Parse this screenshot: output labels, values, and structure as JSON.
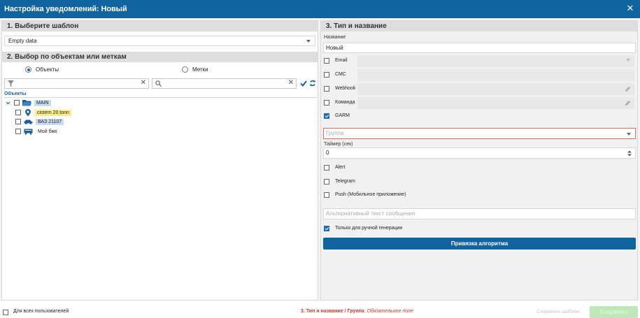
{
  "window": {
    "title": "Настройка уведомлений: Новый"
  },
  "left": {
    "section1_title": "1. Выберите шаблон",
    "template_value": "Empty data",
    "section2_title": "2. Выбор по объектам или меткам",
    "radio_objects": "Объекты",
    "radio_labels": "Метки",
    "tree_title": "Объекты",
    "tree": [
      {
        "label": "MAIN",
        "icon": "folder-icon",
        "highlight": "#c8dcf2"
      },
      {
        "label": "cistern 20 tonn",
        "icon": "map-pin-icon",
        "highlight": "#fbec8c"
      },
      {
        "label": "ВАЗ 21107",
        "icon": "car-icon",
        "highlight": "#c8dcf2"
      },
      {
        "label": "Мой бмх",
        "icon": "truck-icon",
        "highlight": ""
      }
    ]
  },
  "right": {
    "section_title": "3. Тип и название",
    "name_label": "Название",
    "name_value": "Новый",
    "options": [
      {
        "label": "Email",
        "checked": false,
        "field": "select"
      },
      {
        "label": "СМС",
        "checked": false,
        "field": "plain"
      },
      {
        "label": "Webhook",
        "checked": false,
        "field": "edit"
      },
      {
        "label": "Команда",
        "checked": false,
        "field": "edit"
      },
      {
        "label": "GARM",
        "checked": true,
        "field": "none"
      }
    ],
    "group_placeholder": "Группа",
    "timer_label": "Таймер (сек)",
    "timer_value": "0",
    "options2": [
      {
        "label": "Alert",
        "checked": false
      },
      {
        "label": "Telegram",
        "checked": false
      },
      {
        "label": "Push (Мобильное приложение)",
        "checked": false
      }
    ],
    "alt_text_placeholder": "Альтернативный текст сообщения",
    "manual_only_label": "Только для ручной генерации",
    "manual_only_checked": true,
    "algo_button": "Привязка алгоритма"
  },
  "footer": {
    "all_users_label": "Для всех пользователей",
    "error_section": "3. Тип и название / Группа",
    "error_sep": ": ",
    "error_text": "Обязательное поле",
    "save_template": "Сохранить шаблон",
    "save": "Сохранить"
  },
  "colors": {
    "accent": "#0f64a0",
    "error": "#d23a2a",
    "save_disabled": "#bfe8b8"
  }
}
